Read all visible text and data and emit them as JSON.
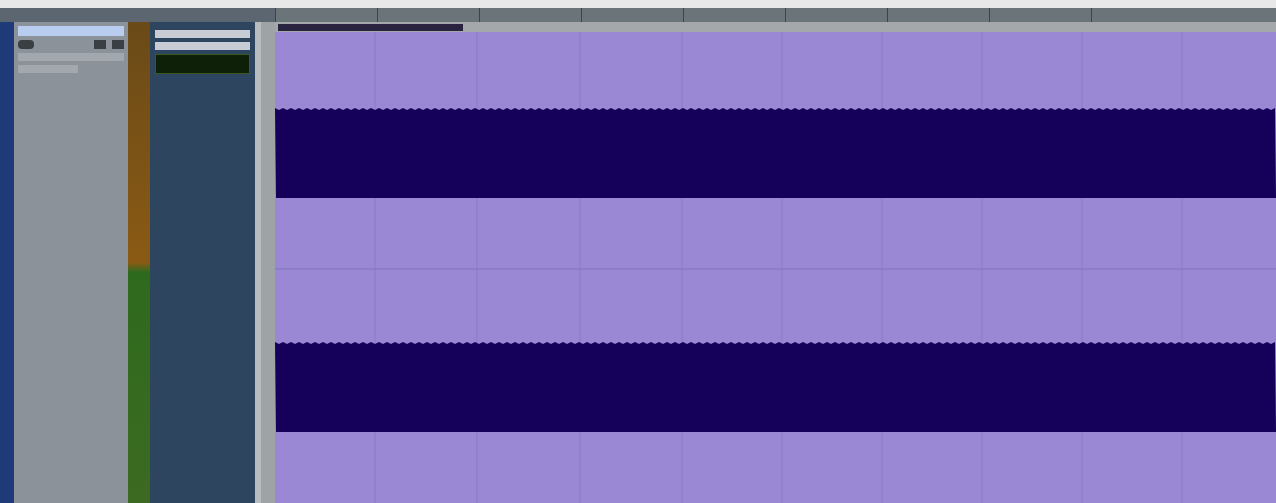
{
  "meter": {
    "level": 1
  }
}
